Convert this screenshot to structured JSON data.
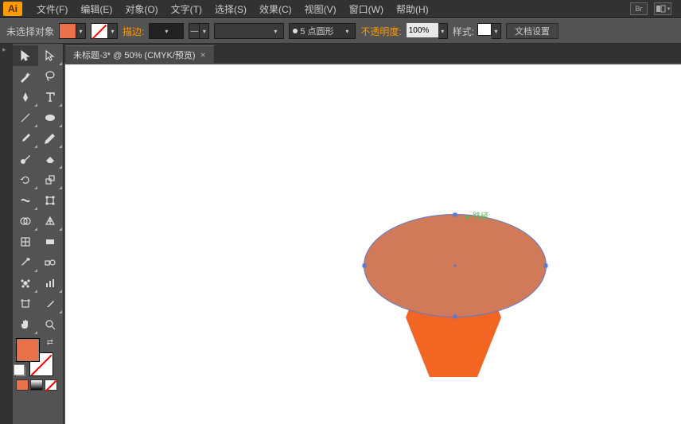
{
  "app": {
    "icon_label": "Ai"
  },
  "menu": {
    "file": "文件(F)",
    "edit": "编辑(E)",
    "object": "对象(O)",
    "text": "文字(T)",
    "select": "选择(S)",
    "effect": "效果(C)",
    "view": "视图(V)",
    "window": "窗口(W)",
    "help": "帮助(H)",
    "br": "Br"
  },
  "control": {
    "selection_status": "未选择对象",
    "stroke_label": "描边:",
    "stroke_weight": "",
    "brush_def": "",
    "point_style": "5 点圆形",
    "opacity_label": "不透明度:",
    "opacity_value": "100%",
    "style_label": "样式:",
    "doc_settings": "文档设置"
  },
  "tab": {
    "title": "未标题-3* @ 50% (CMYK/预览)",
    "close": "×"
  },
  "canvas": {
    "path_label": "路径",
    "hexagon_fill": "#f26522",
    "ellipse_fill": "#d07a5a",
    "ellipse_stroke": "#5a7ad0",
    "fill_color": "#e8714a"
  },
  "tools": {
    "selection": "selection",
    "direct": "direct-selection",
    "wand": "magic-wand",
    "lasso": "lasso",
    "pen": "pen",
    "type": "type",
    "line": "line",
    "ellipse": "ellipse",
    "brush": "brush",
    "pencil": "pencil",
    "blob": "blob-brush",
    "eraser": "eraser",
    "rotate": "rotate",
    "scale": "scale",
    "width": "width",
    "warp": "warp",
    "shapebuilder": "shape-builder",
    "perspective": "perspective",
    "mesh": "mesh",
    "gradient": "gradient",
    "eyedrop": "eyedropper",
    "blend": "blend",
    "symbol": "symbol",
    "graph": "graph",
    "artboard": "artboard",
    "slice": "slice",
    "hand": "hand",
    "zoom": "zoom"
  }
}
